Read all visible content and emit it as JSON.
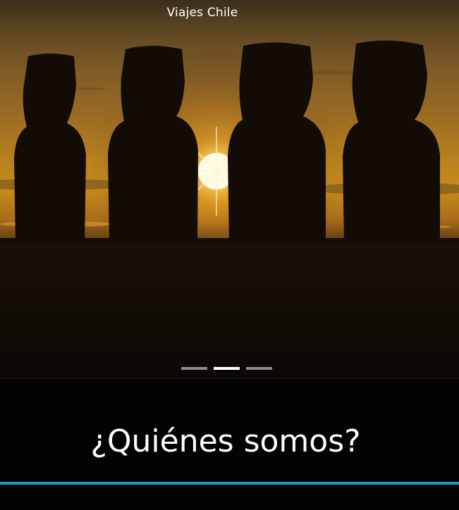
{
  "hero": {
    "title": "Viajes Chile",
    "image": "moai-statues-sunset",
    "carousel": {
      "slides": 3,
      "active_index": 1
    }
  },
  "section": {
    "heading": "¿Quiénes somos?"
  },
  "colors": {
    "accent": "#2d8fbe",
    "background": "#030303",
    "text": "#ffffff",
    "dot_inactive": "#8e8e8e",
    "dot_active": "#ffffff"
  }
}
